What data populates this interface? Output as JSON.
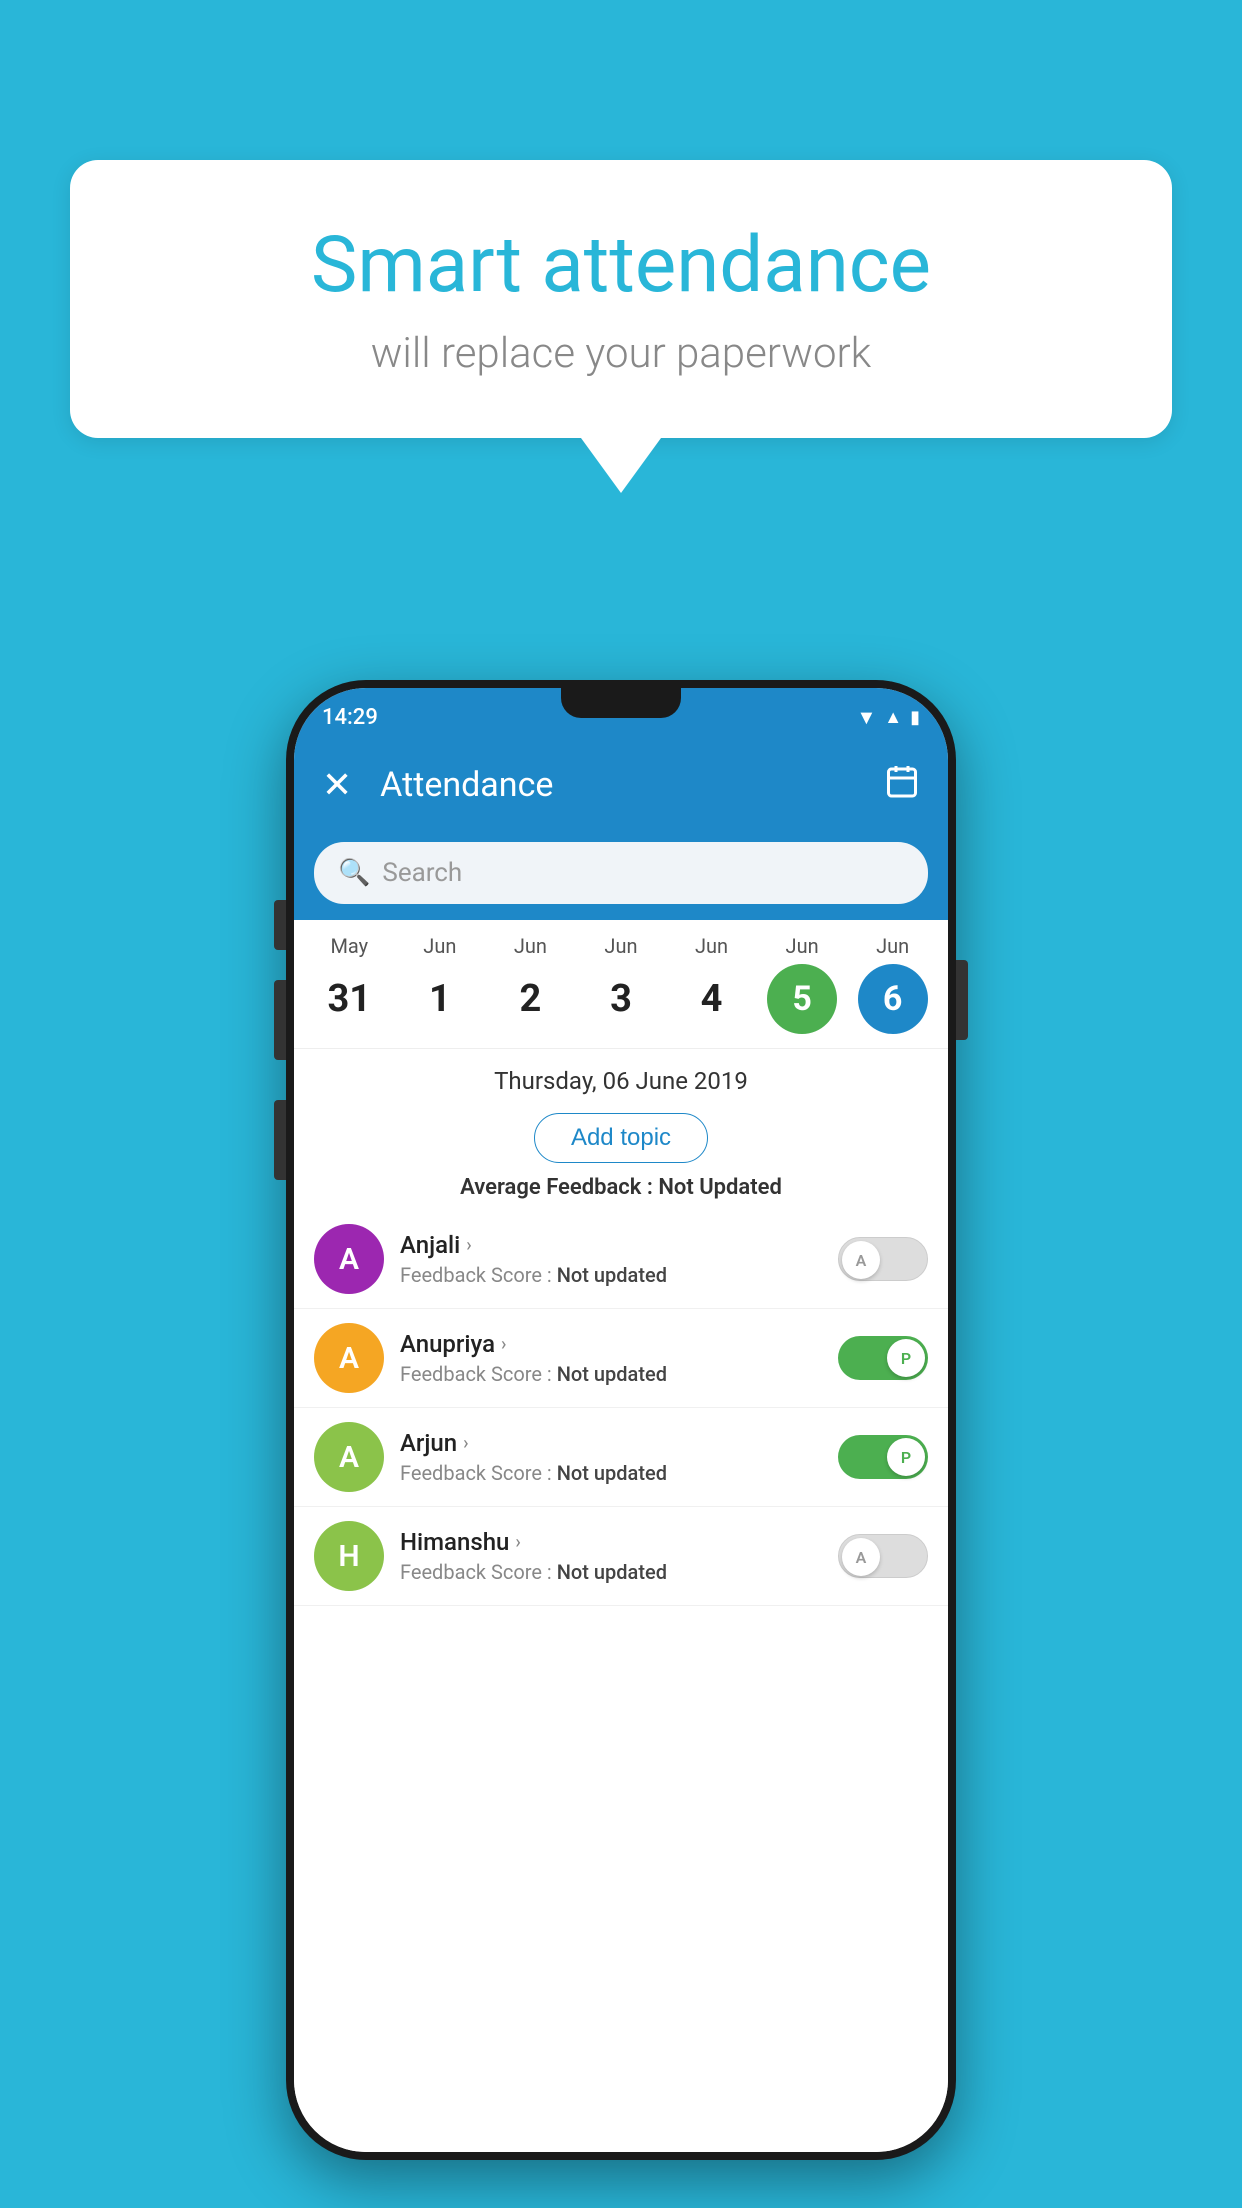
{
  "background_color": "#29b6d8",
  "speech_bubble": {
    "title": "Smart attendance",
    "subtitle": "will replace your paperwork"
  },
  "status_bar": {
    "time": "14:29",
    "icons": [
      "wifi",
      "signal",
      "battery"
    ]
  },
  "app_bar": {
    "title": "Attendance",
    "close_label": "✕",
    "calendar_icon": "📅"
  },
  "search": {
    "placeholder": "Search"
  },
  "calendar": {
    "dates": [
      {
        "month": "May",
        "day": "31",
        "style": "normal"
      },
      {
        "month": "Jun",
        "day": "1",
        "style": "normal"
      },
      {
        "month": "Jun",
        "day": "2",
        "style": "normal"
      },
      {
        "month": "Jun",
        "day": "3",
        "style": "normal"
      },
      {
        "month": "Jun",
        "day": "4",
        "style": "normal"
      },
      {
        "month": "Jun",
        "day": "5",
        "style": "green"
      },
      {
        "month": "Jun",
        "day": "6",
        "style": "blue"
      }
    ]
  },
  "selected_date": "Thursday, 06 June 2019",
  "add_topic_label": "Add topic",
  "average_feedback": {
    "label": "Average Feedback : ",
    "value": "Not Updated"
  },
  "students": [
    {
      "name": "Anjali",
      "avatar_letter": "A",
      "avatar_color": "#9c27b0",
      "feedback_label": "Feedback Score : ",
      "feedback_value": "Not updated",
      "toggle": "off",
      "toggle_label": "A"
    },
    {
      "name": "Anupriya",
      "avatar_letter": "A",
      "avatar_color": "#f5a623",
      "feedback_label": "Feedback Score : ",
      "feedback_value": "Not updated",
      "toggle": "on",
      "toggle_label": "P"
    },
    {
      "name": "Arjun",
      "avatar_letter": "A",
      "avatar_color": "#8bc34a",
      "feedback_label": "Feedback Score : ",
      "feedback_value": "Not updated",
      "toggle": "on",
      "toggle_label": "P"
    },
    {
      "name": "Himanshu",
      "avatar_letter": "H",
      "avatar_color": "#8bc34a",
      "feedback_label": "Feedback Score : ",
      "feedback_value": "Not updated",
      "toggle": "off",
      "toggle_label": "A"
    }
  ]
}
